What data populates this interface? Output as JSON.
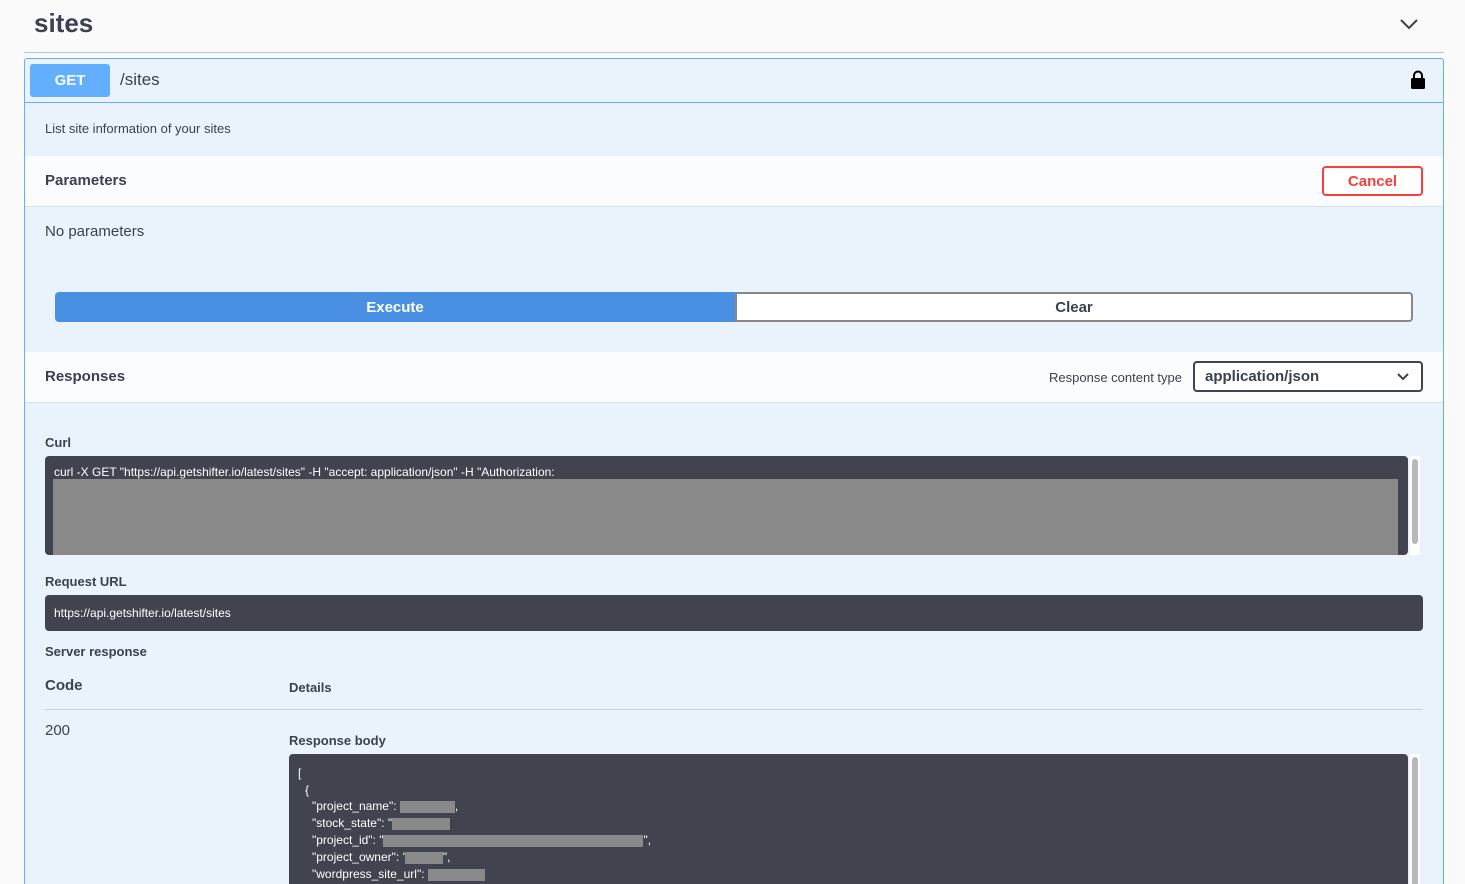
{
  "section": {
    "title": "sites"
  },
  "operation": {
    "method": "GET",
    "path": "/sites",
    "description": "List site information of your sites"
  },
  "parameters": {
    "title": "Parameters",
    "cancel_label": "Cancel",
    "empty_text": "No parameters"
  },
  "actions": {
    "execute_label": "Execute",
    "clear_label": "Clear"
  },
  "responses": {
    "title": "Responses",
    "content_type_label": "Response content type",
    "content_type_value": "application/json"
  },
  "curl": {
    "label": "Curl",
    "command": "curl -X GET \"https://api.getshifter.io/latest/sites\" -H \"accept: application/json\" -H \"Authorization:"
  },
  "request_url": {
    "label": "Request URL",
    "value": "https://api.getshifter.io/latest/sites"
  },
  "server_response": {
    "label": "Server response",
    "code_header": "Code",
    "details_header": "Details",
    "code": "200",
    "body_label": "Response body",
    "body_lines": {
      "open_bracket": "[",
      "open_brace": "{",
      "project_name_key": "\"project_name\": ",
      "stock_state_key": "\"stock_state\": \"",
      "project_id_key": "\"project_id\": \"",
      "project_owner_key": "\"project_owner\": '",
      "wordpress_site_url_key": "\"wordpress_site_url\": ",
      "comma": ",",
      "quote_comma": "\","
    }
  },
  "colors": {
    "get_accent": "#61affe",
    "execute_blue": "#4990e2",
    "cancel_red": "#f93e3e",
    "code_bg": "#41444e",
    "redaction_gray": "#898989"
  }
}
